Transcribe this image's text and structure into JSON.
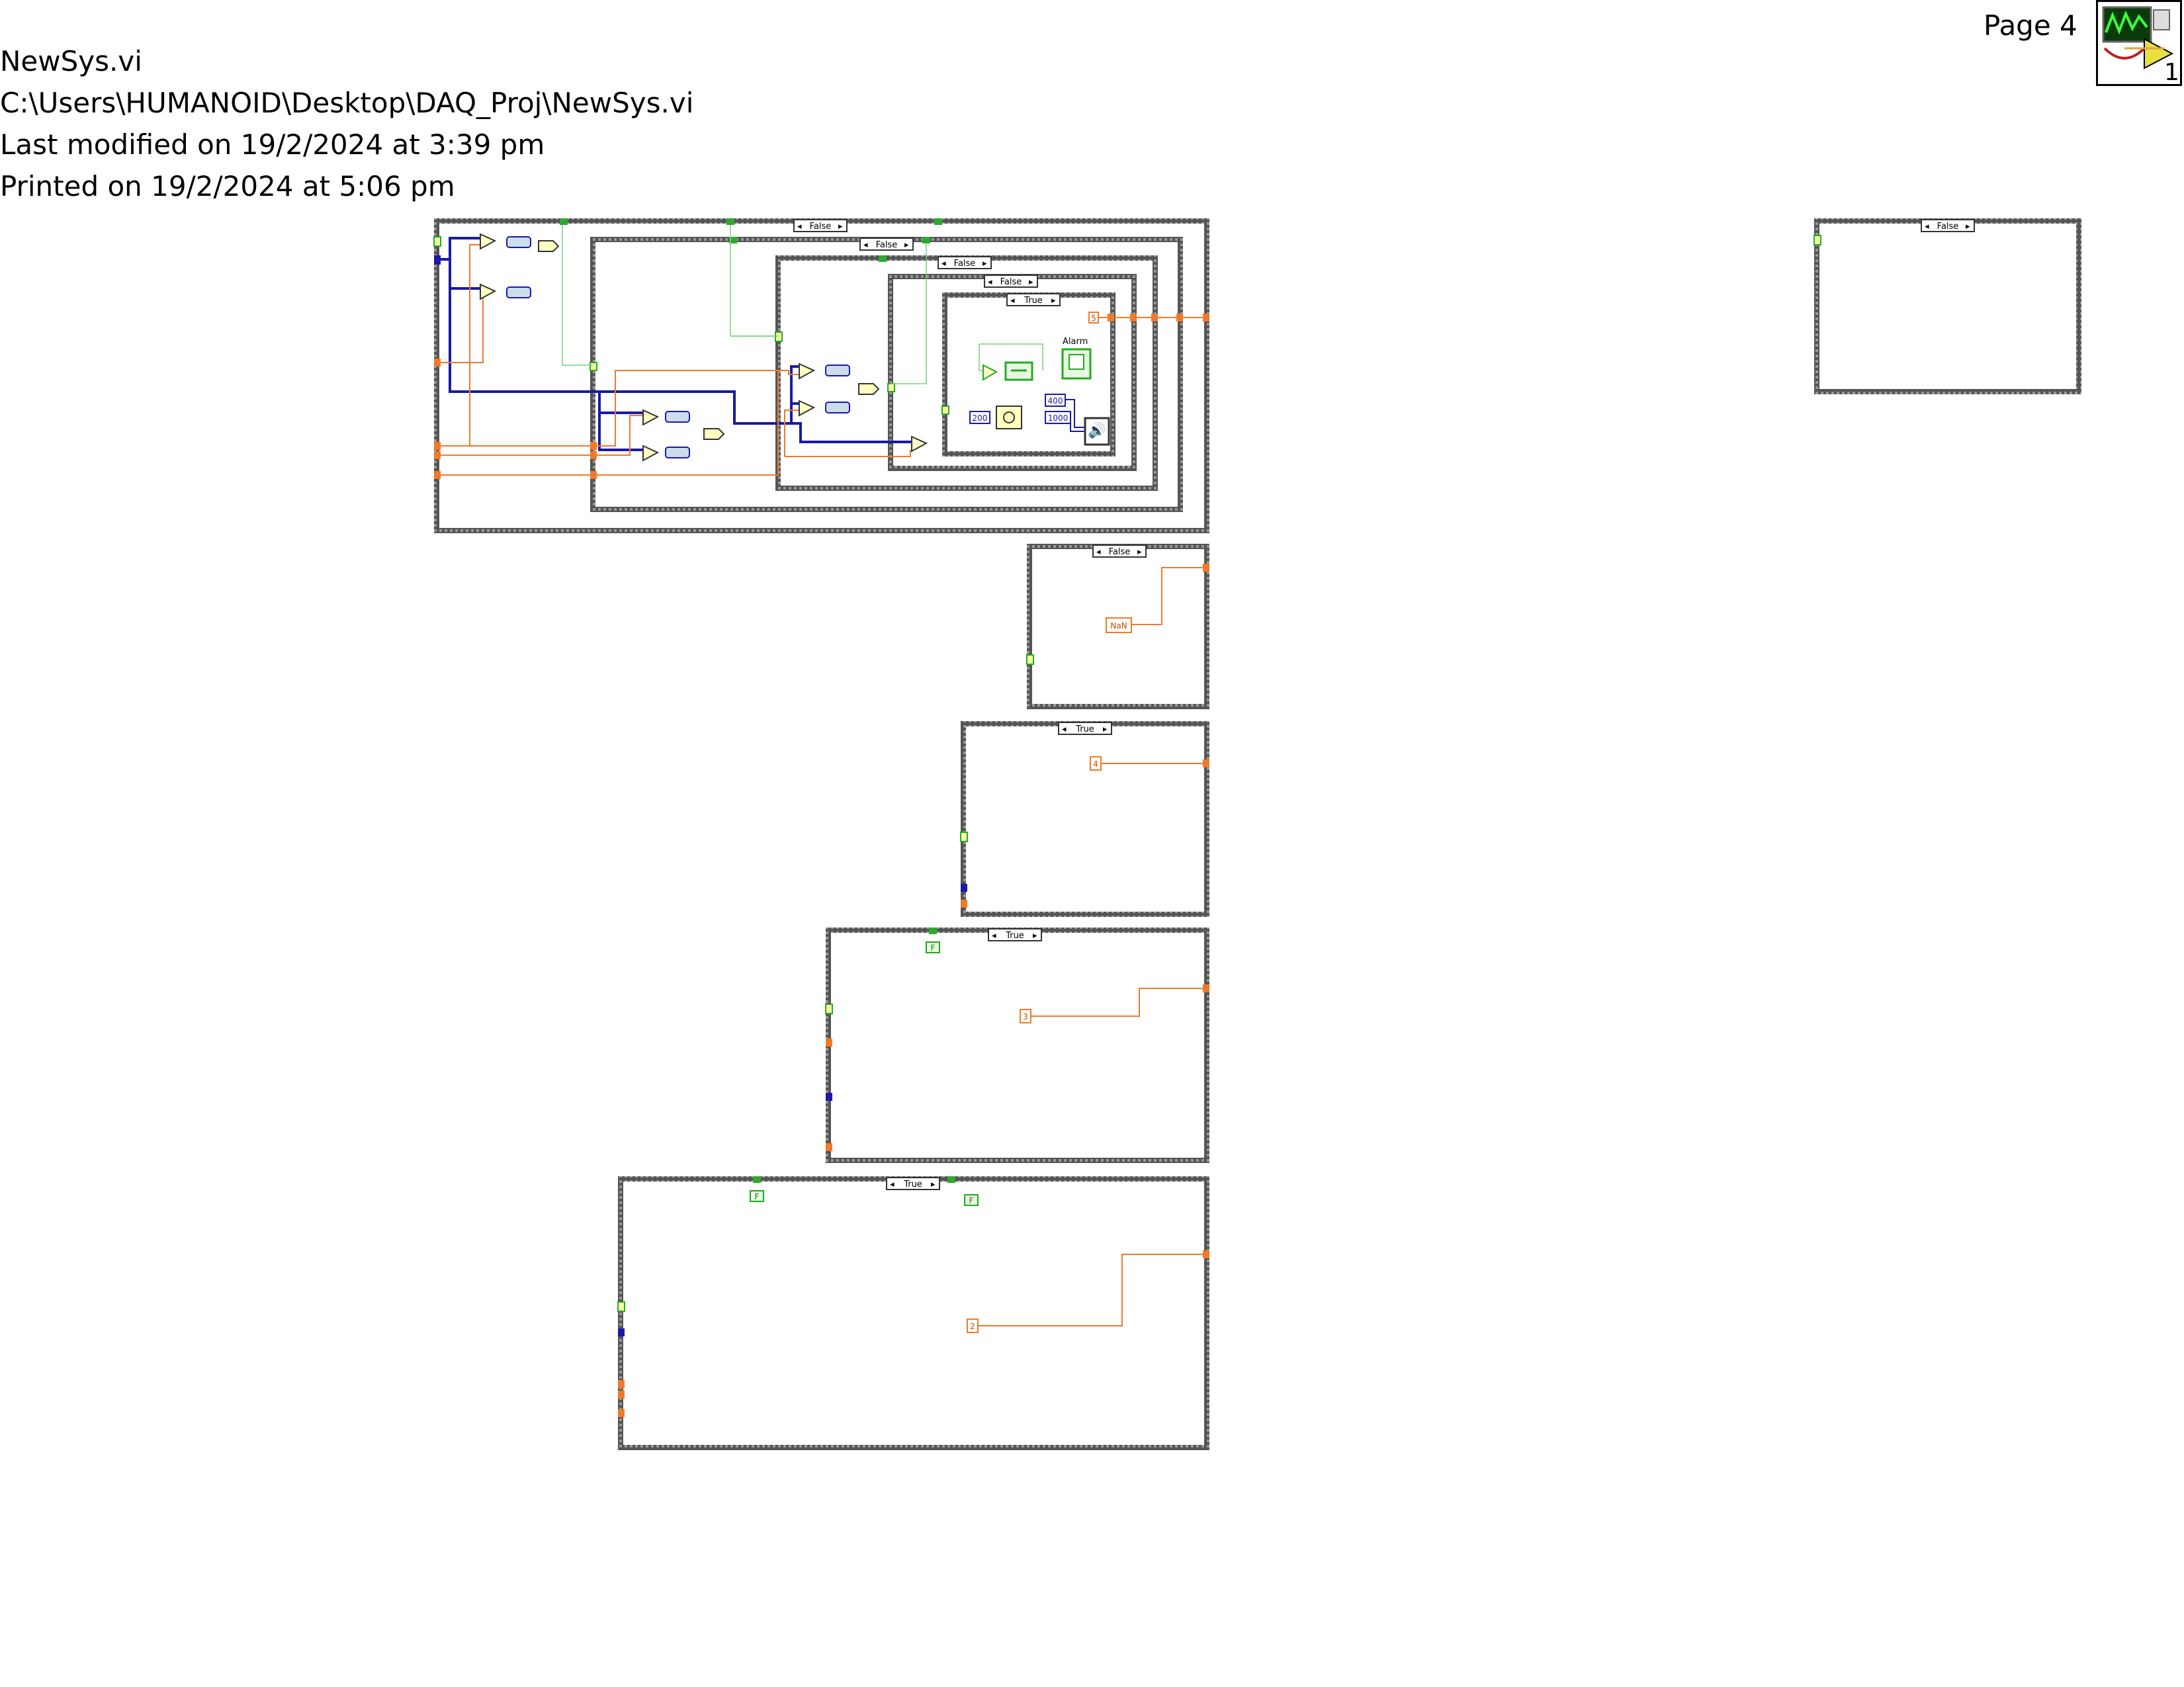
{
  "header": {
    "vi_name": "NewSys.vi",
    "vi_path": "C:\\Users\\HUMANOID\\Desktop\\DAQ_Proj\\NewSys.vi",
    "last_modified": "Last modified on 19/2/2024 at 3:39 pm",
    "printed_on": "Printed on 19/2/2024 at 5:06 pm",
    "page": "Page 4"
  },
  "icon": {
    "name": "vi-icon",
    "corner_number": "1"
  },
  "colors": {
    "case_frame": "#444444",
    "wire_numeric": "#f07a2a",
    "wire_boolean": "#2eaa2e",
    "wire_array": "#1a1aa6",
    "node_fill": "#ffffc0"
  },
  "case_structures": {
    "main": {
      "selector": "False"
    },
    "level2": {
      "selector": "False"
    },
    "level3": {
      "selector": "False"
    },
    "level4": {
      "selector": "False"
    },
    "level5": {
      "selector": "True"
    },
    "right": {
      "selector": "False"
    },
    "nan_case": {
      "selector": "False"
    },
    "case_4": {
      "selector": "True"
    },
    "case_3": {
      "selector": "True"
    },
    "case_2": {
      "selector": "True"
    }
  },
  "constants": {
    "five": "5",
    "two_hundred": "200",
    "four_hundred": "400",
    "one_thousand": "1000",
    "nan": "NaN",
    "four": "4",
    "three": "3",
    "two": "2",
    "false_a": "F",
    "false_b": "F",
    "false_c": "F"
  },
  "labels": {
    "alarm": "Alarm"
  }
}
